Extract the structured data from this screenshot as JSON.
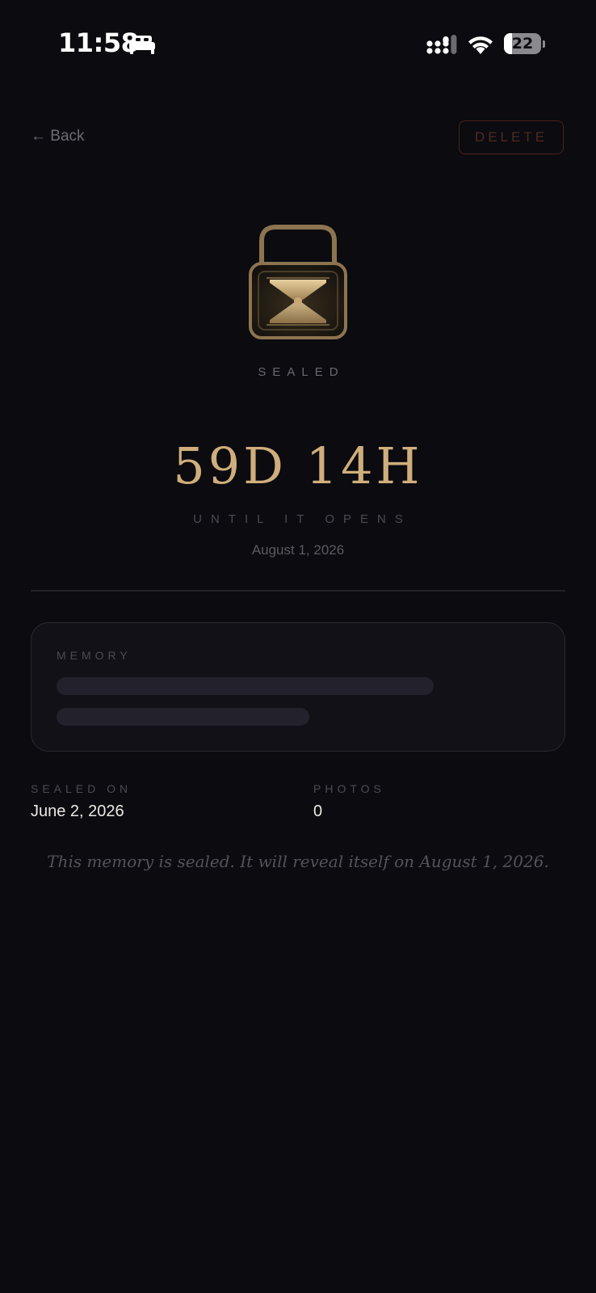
{
  "status_bar": {
    "time": "11:58",
    "battery_level": "22",
    "battery_fraction": 0.22,
    "icons": [
      "bed-icon",
      "cellular-signal-icon",
      "wifi-icon",
      "battery-icon"
    ]
  },
  "header": {
    "back_label": "← Back",
    "delete_label": "DELETE"
  },
  "capsule": {
    "status_label": "SEALED",
    "countdown": "59D 14H",
    "until_label": "UNTIL IT OPENS",
    "open_date": "August 1, 2026",
    "icon": "lock-hourglass-icon"
  },
  "memory": {
    "label": "MEMORY"
  },
  "meta": {
    "sealed_on_label": "SEALED ON",
    "sealed_on_value": "June 2, 2026",
    "photos_label": "PHOTOS",
    "photos_value": "0"
  },
  "note": "This memory is sealed. It will reveal itself on August 1, 2026.",
  "colors": {
    "background": "#0b0b10",
    "accent_gold": "#cfae7c",
    "delete_red": "#4a2219"
  }
}
